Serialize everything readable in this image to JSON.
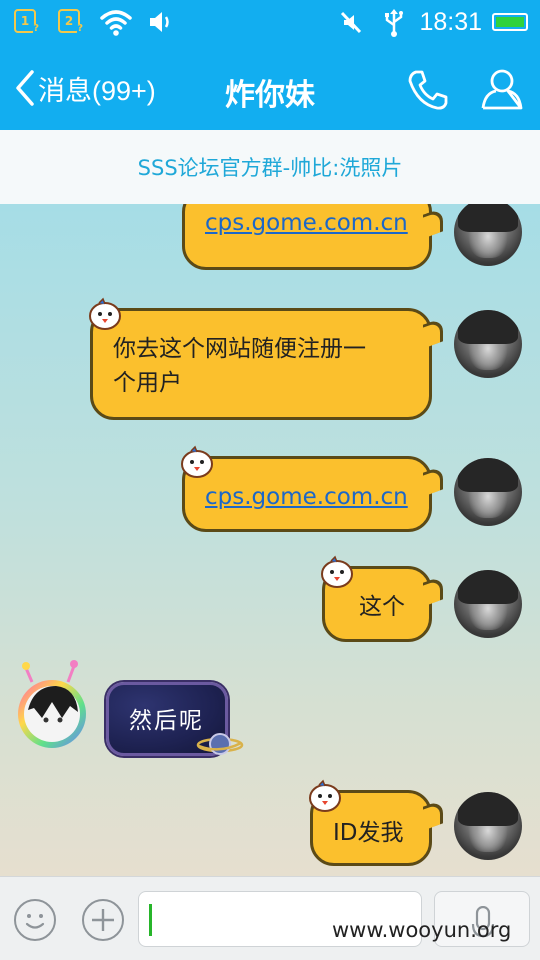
{
  "status_bar": {
    "sim1_label": "1",
    "sim2_label": "2",
    "time": "18:31",
    "icons": [
      "sim1-icon",
      "sim2-icon",
      "wifi-icon",
      "speaker-icon",
      "mute-vibrate-icon",
      "usb-icon",
      "battery-icon"
    ]
  },
  "header": {
    "back_label": "消息(99+)",
    "title": "炸你妹",
    "icons": [
      "back-chevron-icon",
      "phone-icon",
      "person-icon"
    ]
  },
  "notice": {
    "text": "SSS论坛官方群-帅比:洗照片"
  },
  "messages": [
    {
      "side": "right",
      "text": "cps.gome.com.cn",
      "is_link": true
    },
    {
      "side": "right",
      "text_line1": "你去这个网站随便注册一",
      "text_line2": "个用户",
      "is_link": false
    },
    {
      "side": "right",
      "text": "cps.gome.com.cn",
      "is_link": true
    },
    {
      "side": "right",
      "text": "这个",
      "is_link": false
    },
    {
      "side": "left",
      "text": "然后呢",
      "is_link": false
    },
    {
      "side": "right",
      "text": "ID发我",
      "is_link": false
    }
  ],
  "input_bar": {
    "value": "",
    "icons": [
      "emoji-icon",
      "plus-icon",
      "microphone-icon"
    ]
  },
  "watermark": "www.wooyun.org",
  "colors": {
    "header_bg": "#12aef0",
    "bubble_fill": "#fbc02d",
    "link": "#1b67c9",
    "notice_text": "#1fa8d8"
  }
}
